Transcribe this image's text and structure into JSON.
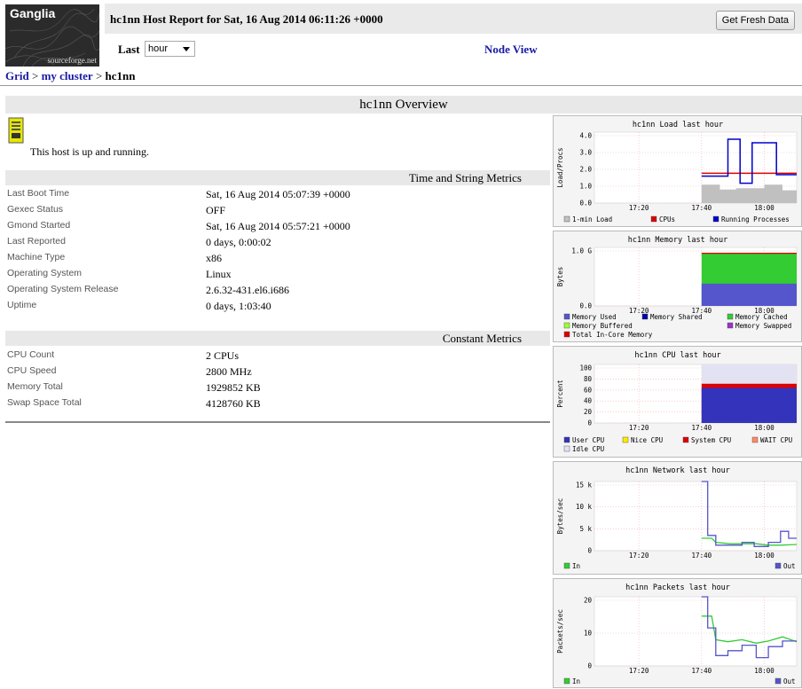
{
  "logo": {
    "title": "Ganglia",
    "subtitle": "sourceforge.net"
  },
  "header": {
    "title": "hc1nn Host Report for Sat, 16 Aug 2014 06:11:26 +0000",
    "fresh_button": "Get Fresh Data",
    "last_label": "Last",
    "range_value": "hour",
    "node_view": "Node View"
  },
  "breadcrumb": {
    "grid": "Grid",
    "sep": ">",
    "cluster": "my cluster",
    "host": "hc1nn"
  },
  "overview": {
    "title": "hc1nn Overview",
    "status": "This host is up and running."
  },
  "time_string_metrics": {
    "title": "Time and String Metrics",
    "rows": [
      {
        "k": "Last Boot Time",
        "v": "Sat, 16 Aug 2014 05:07:39 +0000"
      },
      {
        "k": "Gexec Status",
        "v": "OFF"
      },
      {
        "k": "Gmond Started",
        "v": "Sat, 16 Aug 2014 05:57:21 +0000"
      },
      {
        "k": "Last Reported",
        "v": "0 days, 0:00:02"
      },
      {
        "k": "Machine Type",
        "v": "x86"
      },
      {
        "k": "Operating System",
        "v": "Linux"
      },
      {
        "k": "Operating System Release",
        "v": "2.6.32-431.el6.i686"
      },
      {
        "k": "Uptime",
        "v": "0 days, 1:03:40"
      }
    ]
  },
  "constant_metrics": {
    "title": "Constant Metrics",
    "rows": [
      {
        "k": "CPU Count",
        "v": "2 CPUs"
      },
      {
        "k": "CPU Speed",
        "v": "2800 MHz"
      },
      {
        "k": "Memory Total",
        "v": "1929852 KB"
      },
      {
        "k": "Swap Space Total",
        "v": "4128760 KB"
      }
    ]
  },
  "graphs": {
    "load": {
      "title": "hc1nn Load last hour",
      "ylabel": "Load/Procs",
      "yticks": [
        "4.0",
        "3.0",
        "2.0",
        "1.0",
        "0.0"
      ],
      "xticks": [
        "17:20",
        "17:40",
        "18:00"
      ],
      "legend": [
        "1-min Load",
        "CPUs",
        "Running Processes"
      ],
      "colors": [
        "#c0c0c0",
        "#dd0000",
        "#0000cc"
      ]
    },
    "memory": {
      "title": "hc1nn Memory last hour",
      "ylabel": "Bytes",
      "yticks": [
        "1.0 G",
        "0.0"
      ],
      "xticks": [
        "17:20",
        "17:40",
        "18:00"
      ],
      "legend": [
        "Memory Used",
        "Memory Shared",
        "Memory Cached",
        "Memory Buffered",
        "Memory Swapped",
        "Total In-Core Memory"
      ],
      "colors": [
        "#5555cc",
        "#0000aa",
        "#33cc33",
        "#99ff33",
        "#9933cc",
        "#dd0000"
      ]
    },
    "cpu": {
      "title": "hc1nn CPU last hour",
      "ylabel": "Percent",
      "yticks": [
        "100",
        "80",
        "60",
        "40",
        "20",
        "0"
      ],
      "xticks": [
        "17:20",
        "17:40",
        "18:00"
      ],
      "legend": [
        "User CPU",
        "Nice CPU",
        "System CPU",
        "WAIT CPU",
        "Idle CPU"
      ],
      "colors": [
        "#3333bb",
        "#ffea00",
        "#dd0000",
        "#ff8a60",
        "#e2e2f2"
      ]
    },
    "network": {
      "title": "hc1nn Network last hour",
      "ylabel": "Bytes/sec",
      "yticks": [
        "15 k",
        "10 k",
        "5 k",
        "0"
      ],
      "xticks": [
        "17:20",
        "17:40",
        "18:00"
      ],
      "legend": [
        "In",
        "Out"
      ],
      "colors": [
        "#33cc33",
        "#5555cc"
      ]
    },
    "packets": {
      "title": "hc1nn Packets last hour",
      "ylabel": "Packets/sec",
      "yticks": [
        "20",
        "10",
        "0"
      ],
      "xticks": [
        "17:20",
        "17:40",
        "18:00"
      ],
      "legend": [
        "In",
        "Out"
      ],
      "colors": [
        "#33cc33",
        "#5555cc"
      ]
    }
  }
}
